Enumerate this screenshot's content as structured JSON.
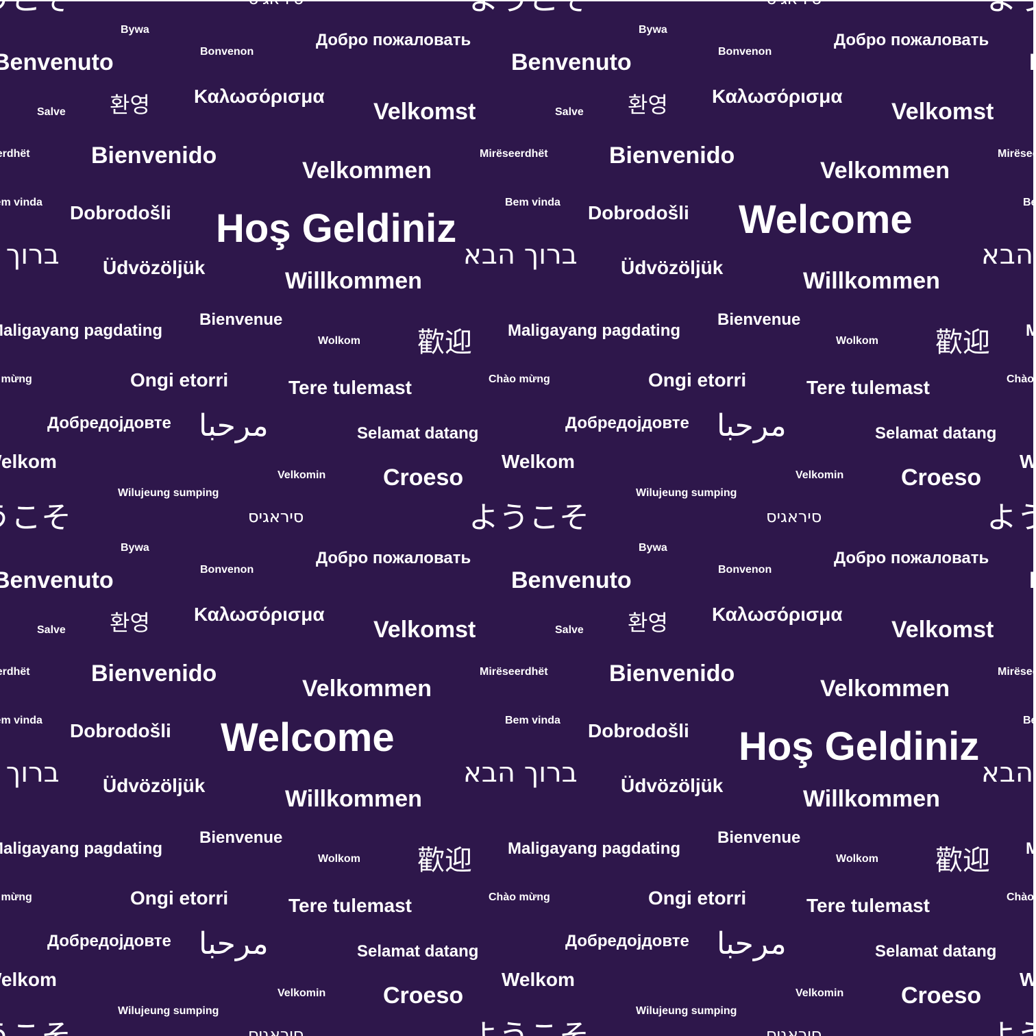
{
  "background_color": "#2e174b",
  "text_color": "#ffffff",
  "words": {
    "bywa": "Bywa",
    "bonvenon": "Bonvenon",
    "dobro_pozhalovat": "Добро пожаловать",
    "benvenuto": "Benvenuto",
    "salve": "Salve",
    "hwanyeong": "환영",
    "kalosorisma": "Καλωσόρισμα",
    "velkomst": "Velkomst",
    "mireseerdhet": "Mirëseerdhët",
    "bienvenido": "Bienvenido",
    "velkommen": "Velkommen",
    "bem_vinda": "Bem vinda",
    "dobrodosli": "Dobrodošli",
    "hos_geldiniz": "Hoş Geldiniz",
    "welcome": "Welcome",
    "baruch_haba": "ברוך הבא",
    "udvozoljuk": "Üdvözöljük",
    "willkommen": "Willkommen",
    "maligayang_pagdating": "Maligayang pagdating",
    "bienvenue": "Bienvenue",
    "wolkom": "Wolkom",
    "huanying": "歡迎",
    "chao_mung": "Chào mừng",
    "ongi_etorri": "Ongi etorri",
    "tere_tulemast": "Tere tulemast",
    "dobredojdovte": "Добредојдовте",
    "marhaban": "مرحبا",
    "selamat_datang": "Selamat datang",
    "welkom": "Welkom",
    "velkomin": "Velkomin",
    "croeso": "Croeso",
    "wilujeung_sumping": "Wilujeung sumping",
    "youkoso": "ようこそ",
    "sirogyo": "סיראגיס"
  }
}
